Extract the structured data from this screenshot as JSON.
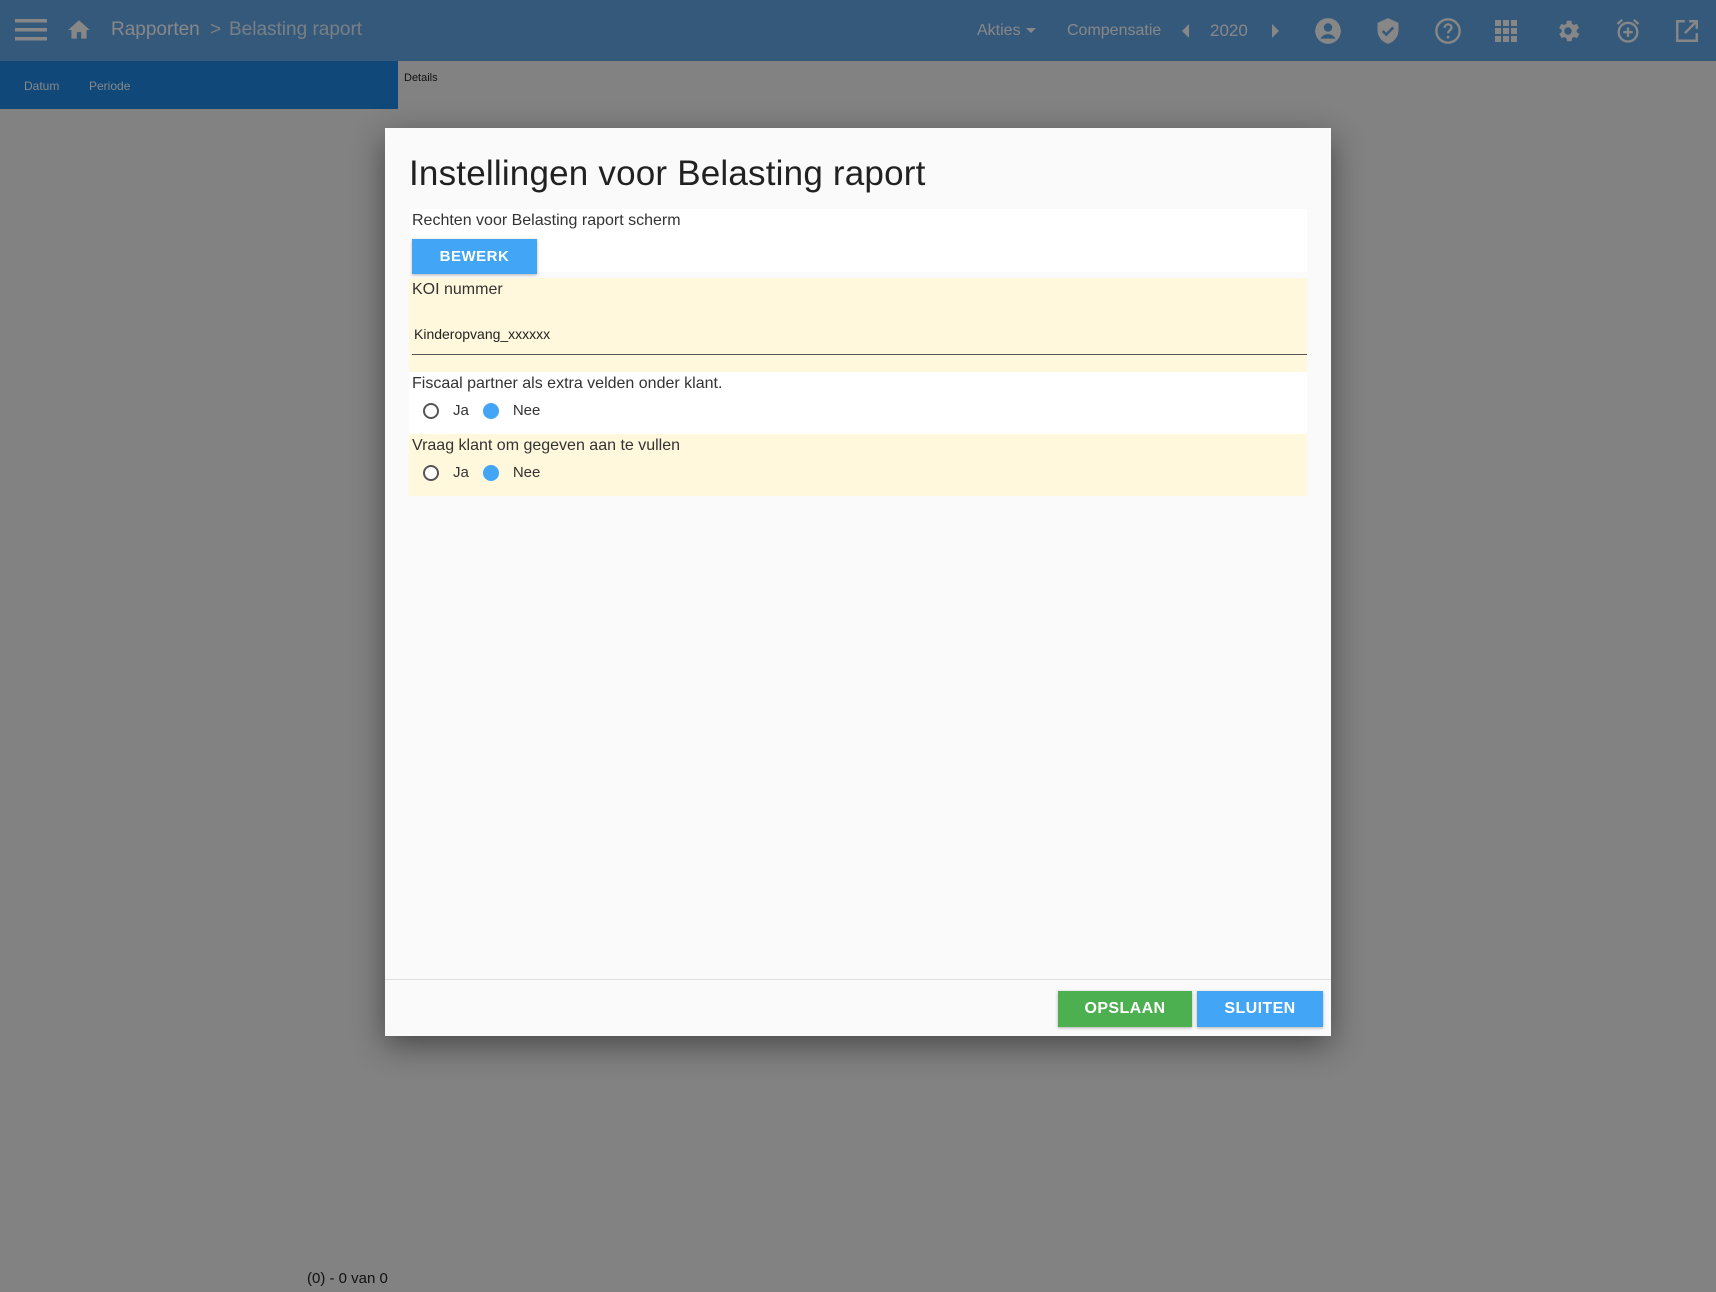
{
  "header": {
    "breadcrumb": [
      "Rapporten",
      "Belasting raport"
    ],
    "breadcrumb_separator": ">",
    "actions_label": "Akties",
    "compensation_label": "Compensatie",
    "year": "2020",
    "icons": [
      "menu-icon",
      "home-icon",
      "caret-down-icon",
      "chevron-left-icon",
      "chevron-right-icon",
      "account-icon",
      "shield-icon",
      "help-icon",
      "apps-icon",
      "gear-icon",
      "alarm-add-icon",
      "open-external-icon"
    ],
    "accent_color": "#64a9e8"
  },
  "subtabs": {
    "items": [
      "Datum",
      "Periode"
    ],
    "details_label": "Details",
    "accent_color": "#1e88e5"
  },
  "footer_status": {
    "pager_text": "(0) - 0 van 0"
  },
  "dialog": {
    "title": "Instellingen voor Belasting raport",
    "permissions": {
      "label": "Rechten voor Belasting raport scherm",
      "edit_button": "BEWERK"
    },
    "koi": {
      "label": "KOI nummer",
      "value": "Kinderopvang_xxxxxx"
    },
    "fiscal_partner": {
      "label": "Fiscaal partner als extra velden onder klant.",
      "options": [
        "Ja",
        "Nee"
      ],
      "selected": "Nee"
    },
    "ask_client": {
      "label": "Vraag klant om gegeven aan te vullen",
      "options": [
        "Ja",
        "Nee"
      ],
      "selected": "Nee"
    },
    "save_button": "OPSLAAN",
    "close_button": "SLUITEN",
    "colors": {
      "save": "#4caf50",
      "primary": "#42a5f5",
      "highlight_row": "#fff8dc"
    }
  }
}
